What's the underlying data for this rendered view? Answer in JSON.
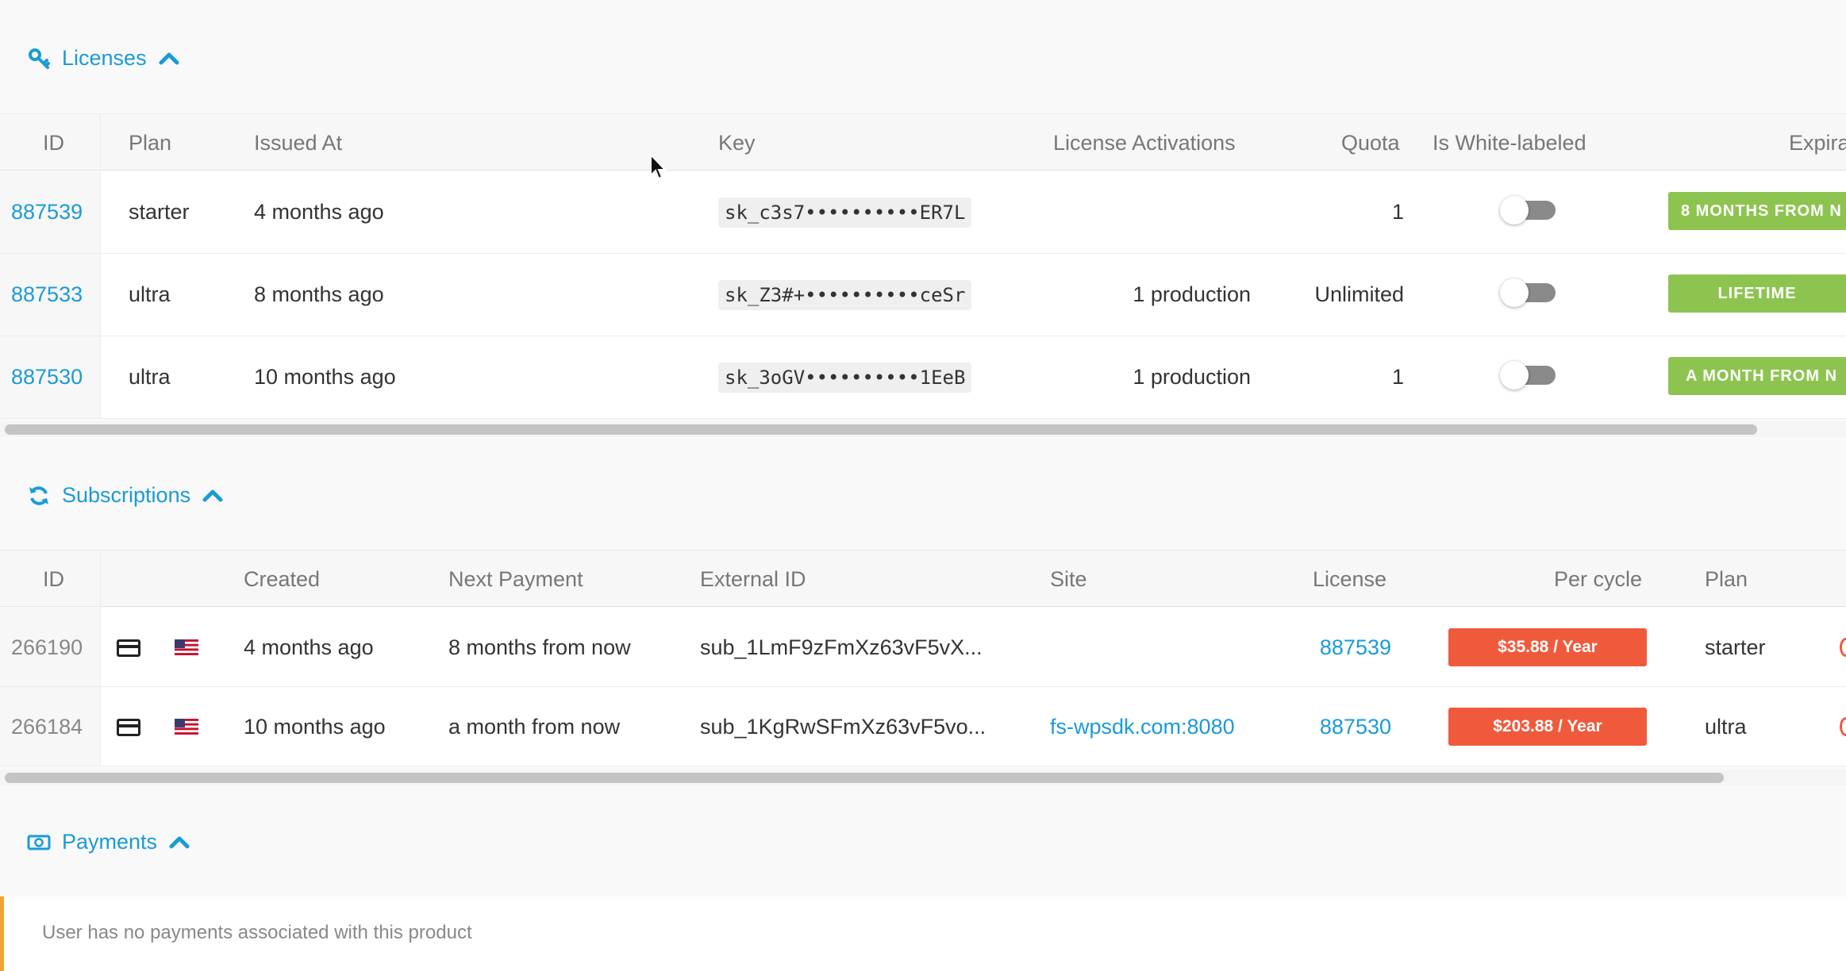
{
  "licenses": {
    "title": "Licenses",
    "icon": "key-icon",
    "columns": [
      "ID",
      "Plan",
      "Issued At",
      "Key",
      "License Activations",
      "Quota",
      "Is White-labeled",
      "Expira"
    ],
    "rows": [
      {
        "id": "887539",
        "plan": "starter",
        "issued": "4 months ago",
        "key": "sk_c3s7••••••••••ER7L",
        "activations": "",
        "quota": "1",
        "white_labeled": false,
        "expiration": "8 MONTHS FROM N"
      },
      {
        "id": "887533",
        "plan": "ultra",
        "issued": "8 months ago",
        "key": "sk_Z3#+••••••••••ceSr",
        "activations": "1 production",
        "quota": "Unlimited",
        "white_labeled": false,
        "expiration": "LIFETIME"
      },
      {
        "id": "887530",
        "plan": "ultra",
        "issued": "10 months ago",
        "key": "sk_3oGV••••••••••1EeB",
        "activations": "1 production",
        "quota": "1",
        "white_labeled": false,
        "expiration": "A MONTH FROM N"
      }
    ]
  },
  "subscriptions": {
    "title": "Subscriptions",
    "icon": "refresh-icon",
    "columns": [
      "ID",
      "Created",
      "Next Payment",
      "External ID",
      "Site",
      "License",
      "Per cycle",
      "Plan"
    ],
    "rows": [
      {
        "id": "266190",
        "created": "4 months ago",
        "next_payment": "8 months from now",
        "external_id": "sub_1LmF9zFmXz63vF5vX...",
        "site": "",
        "license": "887539",
        "per_cycle": "$35.88 / Year",
        "plan": "starter"
      },
      {
        "id": "266184",
        "created": "10 months ago",
        "next_payment": "a month from now",
        "external_id": "sub_1KgRwSFmXz63vF5vo...",
        "site": "fs-wpsdk.com:8080",
        "license": "887530",
        "per_cycle": "$203.88 / Year",
        "plan": "ultra"
      }
    ]
  },
  "payments": {
    "title": "Payments",
    "icon": "money-icon",
    "empty_message": "User has no payments associated with this product"
  },
  "colors": {
    "accent": "#1a9bd7",
    "expiration_badge": "#8dc44f",
    "price_badge": "#f05a3c",
    "notice_border": "#f0a431"
  }
}
